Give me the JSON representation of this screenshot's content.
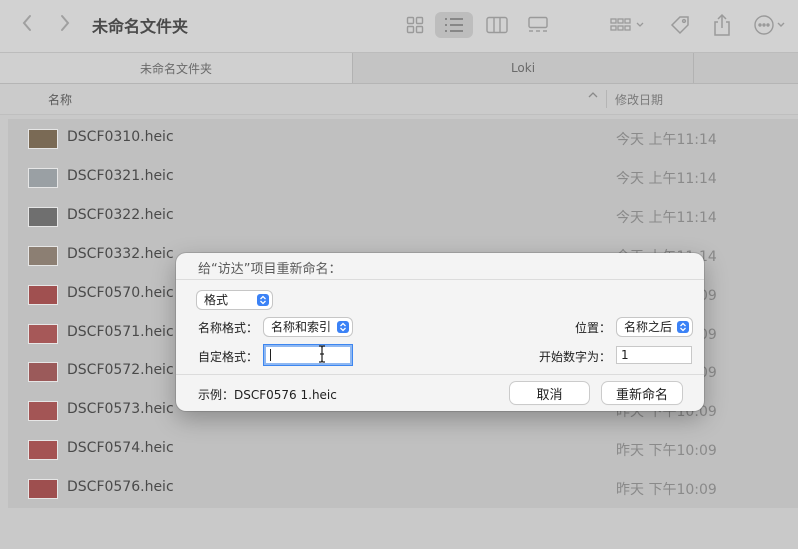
{
  "window": {
    "title": "未命名文件夹"
  },
  "toolbar": {
    "back_icon": "chevron-left-icon",
    "forward_icon": "chevron-right-icon",
    "view_modes": [
      "icon-view",
      "list-view",
      "column-view",
      "gallery-view"
    ],
    "active_view": "list-view",
    "actions": [
      "group-icon",
      "tag-icon",
      "share-icon",
      "more-icon"
    ]
  },
  "tabs": [
    {
      "label": "未命名文件夹",
      "active": true
    },
    {
      "label": "Loki",
      "active": false
    }
  ],
  "columns": {
    "name": "名称",
    "date": "修改日期"
  },
  "files": [
    {
      "name": "DSCF0310.heic",
      "date": "今天 上午11:14",
      "thumb": "#7a6a55"
    },
    {
      "name": "DSCF0321.heic",
      "date": "今天 上午11:14",
      "thumb": "#9aa0a4"
    },
    {
      "name": "DSCF0322.heic",
      "date": "今天 上午11:14",
      "thumb": "#6f6f6f"
    },
    {
      "name": "DSCF0332.heic",
      "date": "今天 上午11:14",
      "thumb": "#8c7f73"
    },
    {
      "name": "DSCF0570.heic",
      "date": "昨天 下午10:09",
      "thumb": "#a05050"
    },
    {
      "name": "DSCF0571.heic",
      "date": "昨天 下午10:09",
      "thumb": "#a65858"
    },
    {
      "name": "DSCF0572.heic",
      "date": "昨天 下午10:09",
      "thumb": "#9b5a5a"
    },
    {
      "name": "DSCF0573.heic",
      "date": "昨天 下午10:09",
      "thumb": "#a35555"
    },
    {
      "name": "DSCF0574.heic",
      "date": "昨天 下午10:09",
      "thumb": "#a45252"
    },
    {
      "name": "DSCF0576.heic",
      "date": "昨天 下午10:09",
      "thumb": "#9e4f4f"
    }
  ],
  "dialog": {
    "title": "给“访达”项目重新命名：",
    "format_select": "格式",
    "name_format_label": "名称格式：",
    "name_format_value": "名称和索引",
    "position_label": "位置：",
    "position_value": "名称之后",
    "custom_format_label": "自定格式：",
    "custom_format_value": "",
    "start_number_label": "开始数字为：",
    "start_number_value": "1",
    "example": "示例：DSCF0576 1.heic",
    "cancel_label": "取消",
    "rename_label": "重新命名",
    "accent": "#3b82f6"
  }
}
